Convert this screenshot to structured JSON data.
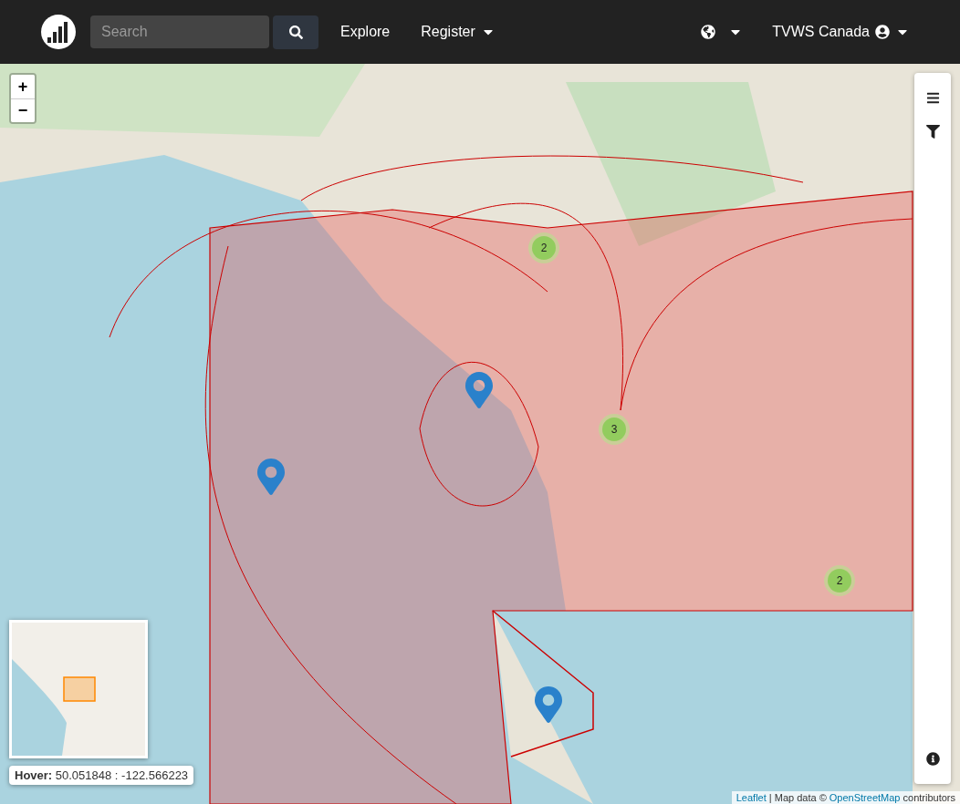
{
  "navbar": {
    "search": {
      "placeholder": "Search"
    },
    "links": [
      {
        "label": "Explore",
        "dropdown": false
      },
      {
        "label": "Register",
        "dropdown": true
      }
    ],
    "language_dropdown": true,
    "user": {
      "name": "TVWS Canada",
      "dropdown": true
    }
  },
  "map": {
    "zoom_controls": [
      "+",
      "−"
    ],
    "clusters": [
      {
        "count": "2"
      },
      {
        "count": "3"
      },
      {
        "count": "2"
      }
    ],
    "hover": "**Hover:** 50.051848 : -122.566223",
    "attribution": [
      {
        "kind": "link",
        "text": "Leaflet"
      },
      {
        "kind": "text",
        "text": " | Map data © "
      },
      {
        "kind": "link",
        "text": "OpenStreetMap"
      },
      {
        "kind": "text",
        "text": " contributors"
      }
    ]
  }
}
